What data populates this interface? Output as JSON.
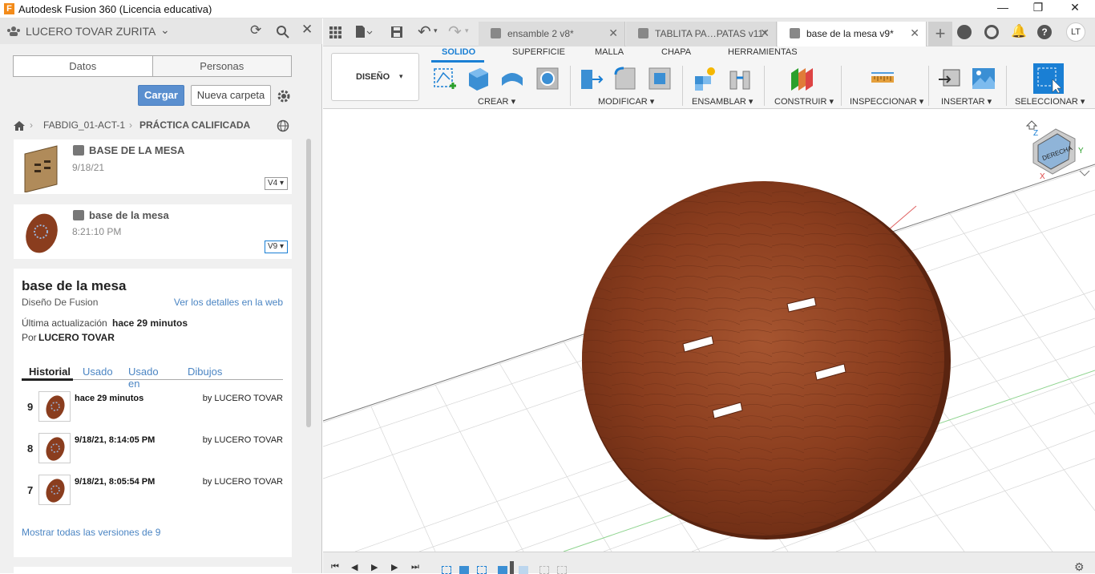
{
  "window": {
    "title": "Autodesk Fusion 360 (Licencia educativa)",
    "logo_letter": "F"
  },
  "data_panel": {
    "user": "LUCERO TOVAR ZURITA",
    "tabs": [
      "Datos",
      "Personas"
    ],
    "upload_label": "Cargar",
    "new_folder_label": "Nueva carpeta",
    "breadcrumb": [
      "FABDIG_01-ACT-1",
      "PRÁCTICA CALIFICADA"
    ],
    "files": [
      {
        "name": "BASE DE LA MESA",
        "date": "9/18/21",
        "version": "V4"
      },
      {
        "name": "base de la mesa",
        "date": "8:21:10 PM",
        "version": "V9"
      }
    ],
    "details": {
      "title": "base de la mesa",
      "type": "Diseño De Fusion",
      "web_link": "Ver los detalles en la web",
      "updated_label": "Última actualización",
      "updated_value": "hace 29 minutos",
      "by_label": "Por",
      "by_value": "LUCERO TOVAR",
      "tabs": [
        "Historial",
        "Usado",
        "Usado en",
        "Dibujos"
      ],
      "history": [
        {
          "num": "9",
          "date": "hace 29 minutos",
          "by": "by LUCERO TOVAR"
        },
        {
          "num": "8",
          "date": "9/18/21, 8:14:05 PM",
          "by": "by LUCERO TOVAR"
        },
        {
          "num": "7",
          "date": "9/18/21, 8:05:54 PM",
          "by": "by LUCERO TOVAR"
        }
      ],
      "show_all": "Mostrar todas las versiones de 9"
    }
  },
  "doc_tabs": [
    {
      "label": "ensamble 2 v8*"
    },
    {
      "label": "TABLITA PA…PATAS v11*"
    },
    {
      "label": "base de la mesa v9*"
    }
  ],
  "user_initials": "LT",
  "ribbon": {
    "workspace": "DISEÑO",
    "tabs": [
      "SOLIDO",
      "SUPERFICIE",
      "MALLA",
      "CHAPA",
      "HERRAMIENTAS"
    ],
    "groups": [
      "CREAR",
      "MODIFICAR",
      "ENSAMBLAR",
      "CONSTRUIR",
      "INSPECCIONAR",
      "INSERTAR",
      "SELECCIONAR"
    ]
  },
  "viewcube": {
    "face": "DERECHA",
    "axis_z": "Z",
    "axis_y": "Y",
    "axis_x": "X"
  },
  "colors": {
    "accent": "#1a7fd4",
    "upload": "#5a8fcf",
    "link": "#4b85c3",
    "wood": "#8a3d1e"
  }
}
